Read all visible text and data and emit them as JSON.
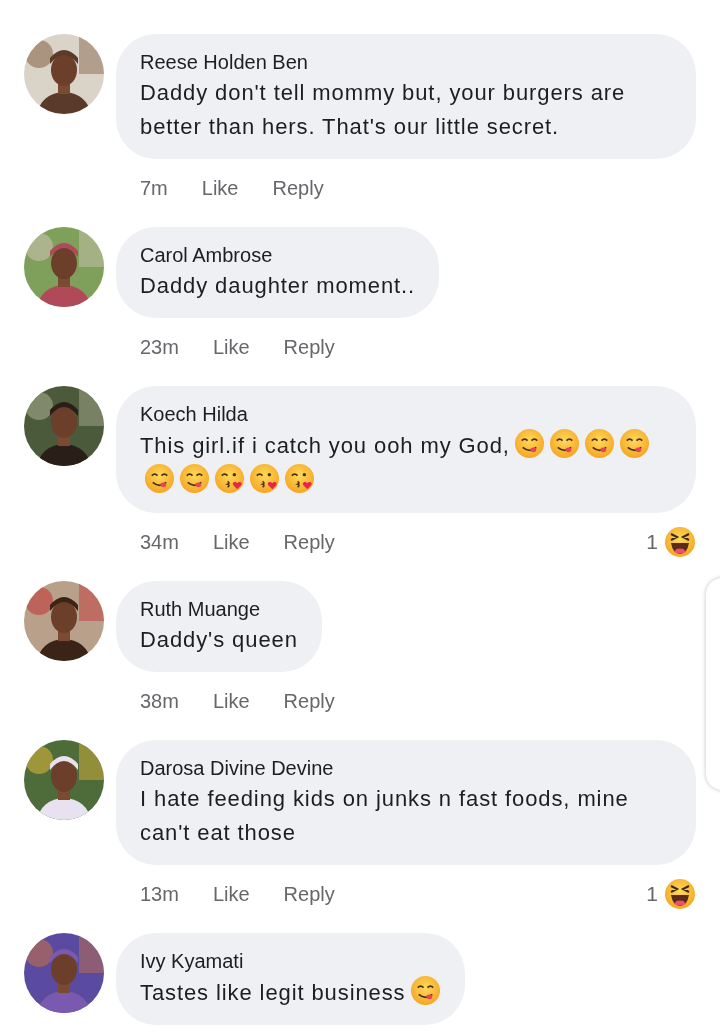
{
  "comments": [
    {
      "author": "Reese Holden Ben",
      "text": "Daddy don't tell mommy but, your burgers are better than hers. That's our little secret.",
      "time": "7m",
      "like": "Like",
      "reply": "Reply"
    },
    {
      "author": "Carol Ambrose",
      "text": "Daddy daughter moment..",
      "time": "23m",
      "like": "Like",
      "reply": "Reply"
    },
    {
      "author": "Koech Hilda",
      "text": "This girl.if i catch you ooh my God,",
      "emojis": [
        {
          "kind": "yum"
        },
        {
          "kind": "yum"
        },
        {
          "kind": "yum"
        },
        {
          "kind": "yum"
        },
        {
          "kind": "yum"
        },
        {
          "kind": "yum"
        },
        {
          "kind": "kiss"
        },
        {
          "kind": "kiss"
        },
        {
          "kind": "kiss"
        }
      ],
      "time": "34m",
      "like": "Like",
      "reply": "Reply",
      "reaction": {
        "count": "1",
        "kind": "haha"
      }
    },
    {
      "author": "Ruth Muange",
      "text": "Daddy's queen",
      "time": "38m",
      "like": "Like",
      "reply": "Reply"
    },
    {
      "author": "Darosa Divine Devine",
      "text": "I hate feeding kids on junks n fast foods, mine can't eat those",
      "time": "13m",
      "like": "Like",
      "reply": "Reply",
      "reaction": {
        "count": "1",
        "kind": "haha"
      }
    },
    {
      "author": "Ivy Kyamati",
      "text": "Tastes like legit business",
      "emojis": [
        {
          "kind": "yum"
        }
      ]
    }
  ]
}
